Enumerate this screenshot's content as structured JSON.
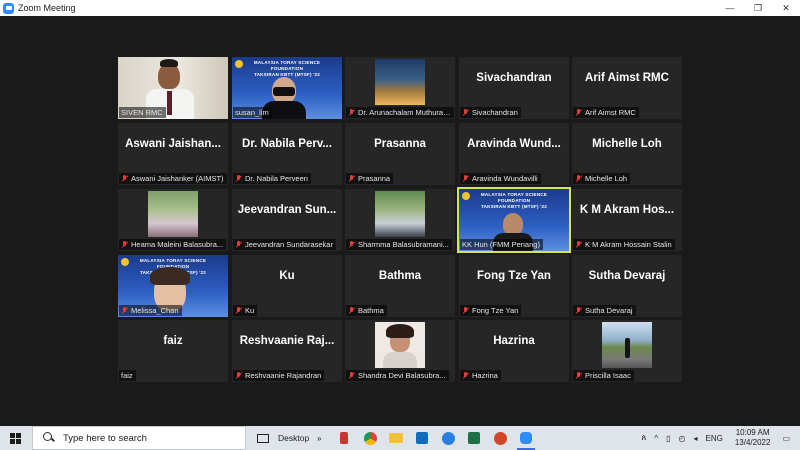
{
  "window": {
    "title": "Zoom Meeting",
    "controls": [
      "—",
      "❐",
      "✕"
    ]
  },
  "colors": {
    "stage_bg": "#1a1a1a",
    "tile_bg": "#262626",
    "active_speaker": "#d7e54a",
    "muted_mic": "#e63b3b"
  },
  "banner": {
    "line1": "MALAYSIA TORAY SCIENCE FOUNDATION",
    "line2": "TAKSIRAN KBTT (MTSF) '22"
  },
  "participants": [
    {
      "display": "",
      "label": "SIVEN RMC",
      "muted": false,
      "video": "siven"
    },
    {
      "display": "",
      "label": "susan_lim",
      "muted": false,
      "video": "banner"
    },
    {
      "display": "",
      "label": "Dr. Arunachalam Muthuraman",
      "muted": true,
      "video": "building"
    },
    {
      "display": "Sivachandran",
      "label": "Sivachandran",
      "muted": true
    },
    {
      "display": "Arif Aimst RMC",
      "label": "Arif Aimst RMC",
      "muted": true
    },
    {
      "display": "Aswani  Jaishan...",
      "label": "Aswani Jaishanker (AIMST)",
      "muted": true
    },
    {
      "display": "Dr. Nabila  Perv...",
      "label": "Dr. Nabila Perveen",
      "muted": true
    },
    {
      "display": "Prasanna",
      "label": "Prasanna",
      "muted": true
    },
    {
      "display": "Aravinda  Wund...",
      "label": "Aravinda Wundavilli",
      "muted": true
    },
    {
      "display": "Michelle Loh",
      "label": "Michelle Loh",
      "muted": true
    },
    {
      "display": "",
      "label": "Heama Maleini Balasubra...",
      "muted": true,
      "video": "family"
    },
    {
      "display": "Jeevandran  Sun...",
      "label": "Jeevandran Sundarasekar",
      "muted": true
    },
    {
      "display": "",
      "label": "Sharmma Balasubramani...",
      "muted": true,
      "video": "outdoor"
    },
    {
      "display": "",
      "label": "KK Hun (FMM Penang)",
      "muted": false,
      "video": "banner-speaker",
      "active": true
    },
    {
      "display": "K M Akram  Hos...",
      "label": "K M Akram Hossain Stalin",
      "muted": true
    },
    {
      "display": "",
      "label": "Melissa_Chan",
      "muted": true,
      "video": "banner-woman"
    },
    {
      "display": "Ku",
      "label": "Ku",
      "muted": true
    },
    {
      "display": "Bathma",
      "label": "Bathma",
      "muted": true
    },
    {
      "display": "Fong Tze Yan",
      "label": "Fong Tze Yan",
      "muted": true
    },
    {
      "display": "Sutha Devaraj",
      "label": "Sutha Devaraj",
      "muted": true
    },
    {
      "display": "faiz",
      "label": "faiz",
      "muted": false
    },
    {
      "display": "Reshvaanie  Raj...",
      "label": "Reshvaanie Rajandran",
      "muted": true
    },
    {
      "display": "",
      "label": "Shandra Devi Balasubra...",
      "muted": true,
      "video": "portrait"
    },
    {
      "display": "Hazrina",
      "label": "Hazrina",
      "muted": true
    },
    {
      "display": "",
      "label": "Priscilla Isaac",
      "muted": true,
      "video": "road"
    }
  ],
  "taskbar": {
    "search_placeholder": "Type here to search",
    "desktop_label": "Desktop",
    "apps": [
      "task-view-icon",
      "desktop-toolbar",
      "people-icon",
      "chrome-icon",
      "file-explorer-icon",
      "outlook-icon",
      "edge-icon",
      "excel-icon",
      "powerpoint-icon",
      "zoom-icon"
    ],
    "tray": {
      "language": "ENG",
      "time": "10:09 AM",
      "date": "13/4/2022"
    }
  }
}
